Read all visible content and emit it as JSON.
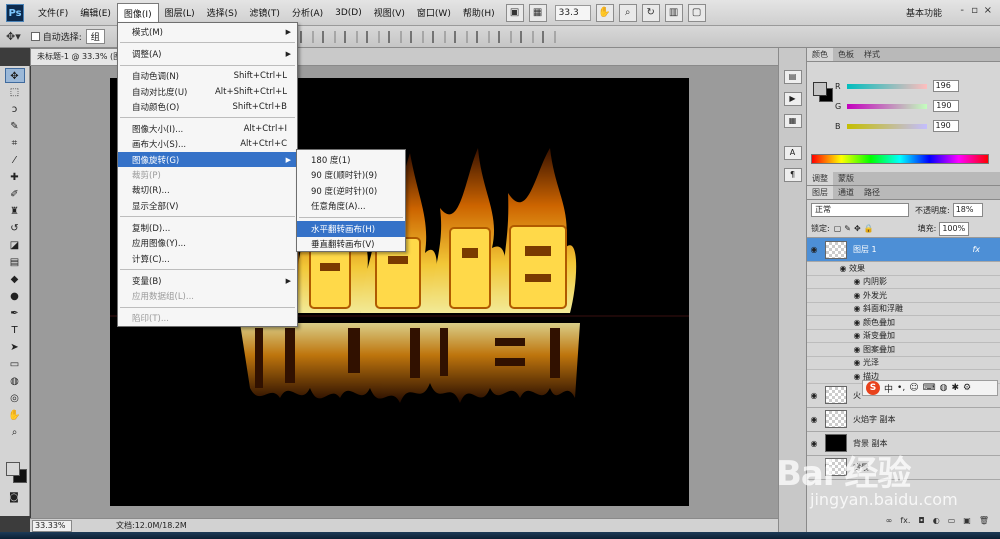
{
  "app": {
    "logo": "Ps",
    "menus": [
      "文件(F)",
      "编辑(E)",
      "图像(I)",
      "图层(L)",
      "选择(S)",
      "滤镜(T)",
      "分析(A)",
      "3D(D)",
      "视图(V)",
      "窗口(W)",
      "帮助(H)"
    ],
    "active_menu_index": 2,
    "zoom_field": "33.3",
    "workspace": "基本功能",
    "window_controls": [
      "-",
      "▫",
      "×"
    ]
  },
  "options_bar": {
    "auto_select_label": "自动选择:",
    "auto_select_value": "组"
  },
  "document": {
    "tab_title": "未标题-1 @ 33.3% (图",
    "status_zoom": "33.33%",
    "status_info": "文档:12.0M/18.2M"
  },
  "image_menu": {
    "items": [
      {
        "label": "模式(M)",
        "shortcut": "",
        "submenu": true,
        "disabled": false
      },
      {
        "sep": true
      },
      {
        "label": "调整(A)",
        "shortcut": "",
        "submenu": true,
        "disabled": false
      },
      {
        "sep": true
      },
      {
        "label": "自动色调(N)",
        "shortcut": "Shift+Ctrl+L",
        "disabled": false
      },
      {
        "label": "自动对比度(U)",
        "shortcut": "Alt+Shift+Ctrl+L",
        "disabled": false
      },
      {
        "label": "自动颜色(O)",
        "shortcut": "Shift+Ctrl+B",
        "disabled": false
      },
      {
        "sep": true
      },
      {
        "label": "图像大小(I)...",
        "shortcut": "Alt+Ctrl+I",
        "disabled": false
      },
      {
        "label": "画布大小(S)...",
        "shortcut": "Alt+Ctrl+C",
        "disabled": false
      },
      {
        "label": "图像旋转(G)",
        "shortcut": "",
        "submenu": true,
        "highlighted": true,
        "disabled": false
      },
      {
        "label": "裁剪(P)",
        "shortcut": "",
        "disabled": true
      },
      {
        "label": "裁切(R)...",
        "shortcut": "",
        "disabled": false
      },
      {
        "label": "显示全部(V)",
        "shortcut": "",
        "disabled": false
      },
      {
        "sep": true
      },
      {
        "label": "复制(D)...",
        "shortcut": "",
        "disabled": false
      },
      {
        "label": "应用图像(Y)...",
        "shortcut": "",
        "disabled": false
      },
      {
        "label": "计算(C)...",
        "shortcut": "",
        "disabled": false
      },
      {
        "sep": true
      },
      {
        "label": "变量(B)",
        "shortcut": "",
        "submenu": true,
        "disabled": false
      },
      {
        "label": "应用数据组(L)...",
        "shortcut": "",
        "disabled": true
      },
      {
        "sep": true
      },
      {
        "label": "陷印(T)...",
        "shortcut": "",
        "disabled": true
      }
    ]
  },
  "rotate_submenu": {
    "items": [
      {
        "label": "180 度(1)"
      },
      {
        "label": "90 度(顺时针)(9)"
      },
      {
        "label": "90 度(逆时针)(0)"
      },
      {
        "label": "任意角度(A)..."
      },
      {
        "sep": true
      },
      {
        "label": "水平翻转画布(H)",
        "highlighted": true
      },
      {
        "label": "垂直翻转画布(V)"
      }
    ]
  },
  "color_panel": {
    "tabs": [
      "颜色",
      "色板",
      "样式"
    ],
    "r_label": "R",
    "r_value": "196",
    "g_label": "G",
    "g_value": "190",
    "b_label": "B",
    "b_value": "190",
    "accent_fg": "#c4bebe"
  },
  "adjust_tabs": [
    "调整",
    "蒙版"
  ],
  "layers_panel": {
    "tabs": [
      "图层",
      "通道",
      "路径"
    ],
    "blend_mode": "正常",
    "opacity_label": "不透明度:",
    "opacity_value": "18%",
    "lock_label": "锁定:",
    "fill_label": "填充:",
    "fill_value": "100%",
    "selected_layer": "图层 1",
    "effects_header": "效果",
    "effects": [
      "内阴影",
      "外发光",
      "斜面和浮雕",
      "颜色叠加",
      "渐变叠加",
      "图案叠加",
      "光泽",
      "描边"
    ],
    "other_layers": [
      {
        "name": "火",
        "thumb": "checker"
      },
      {
        "name": "火焰字 副本",
        "thumb": "checker"
      },
      {
        "name": "背景 副本",
        "thumb": "black"
      },
      {
        "name": "背景",
        "thumb": "checker"
      }
    ],
    "fx_mark": "fx"
  },
  "watermark": {
    "logo": "Bai 经验",
    "url": "jingyan.baidu.com"
  },
  "ime": {
    "label": "中"
  }
}
